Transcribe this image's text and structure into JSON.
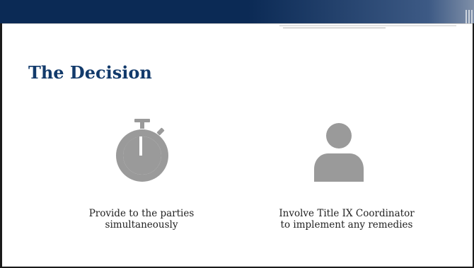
{
  "slide": {
    "title": "The Decision",
    "colors": {
      "header_bar": "#0b2a55",
      "title_text": "#123a6b",
      "icon_gray": "#9a9a9a",
      "body_text": "#222222"
    },
    "items": [
      {
        "icon": "stopwatch-icon",
        "caption_line1": "Provide to the parties",
        "caption_line2": "simultaneously"
      },
      {
        "icon": "person-icon",
        "caption_line1": "Involve Title IX Coordinator",
        "caption_line2": "to implement any remedies"
      }
    ]
  }
}
